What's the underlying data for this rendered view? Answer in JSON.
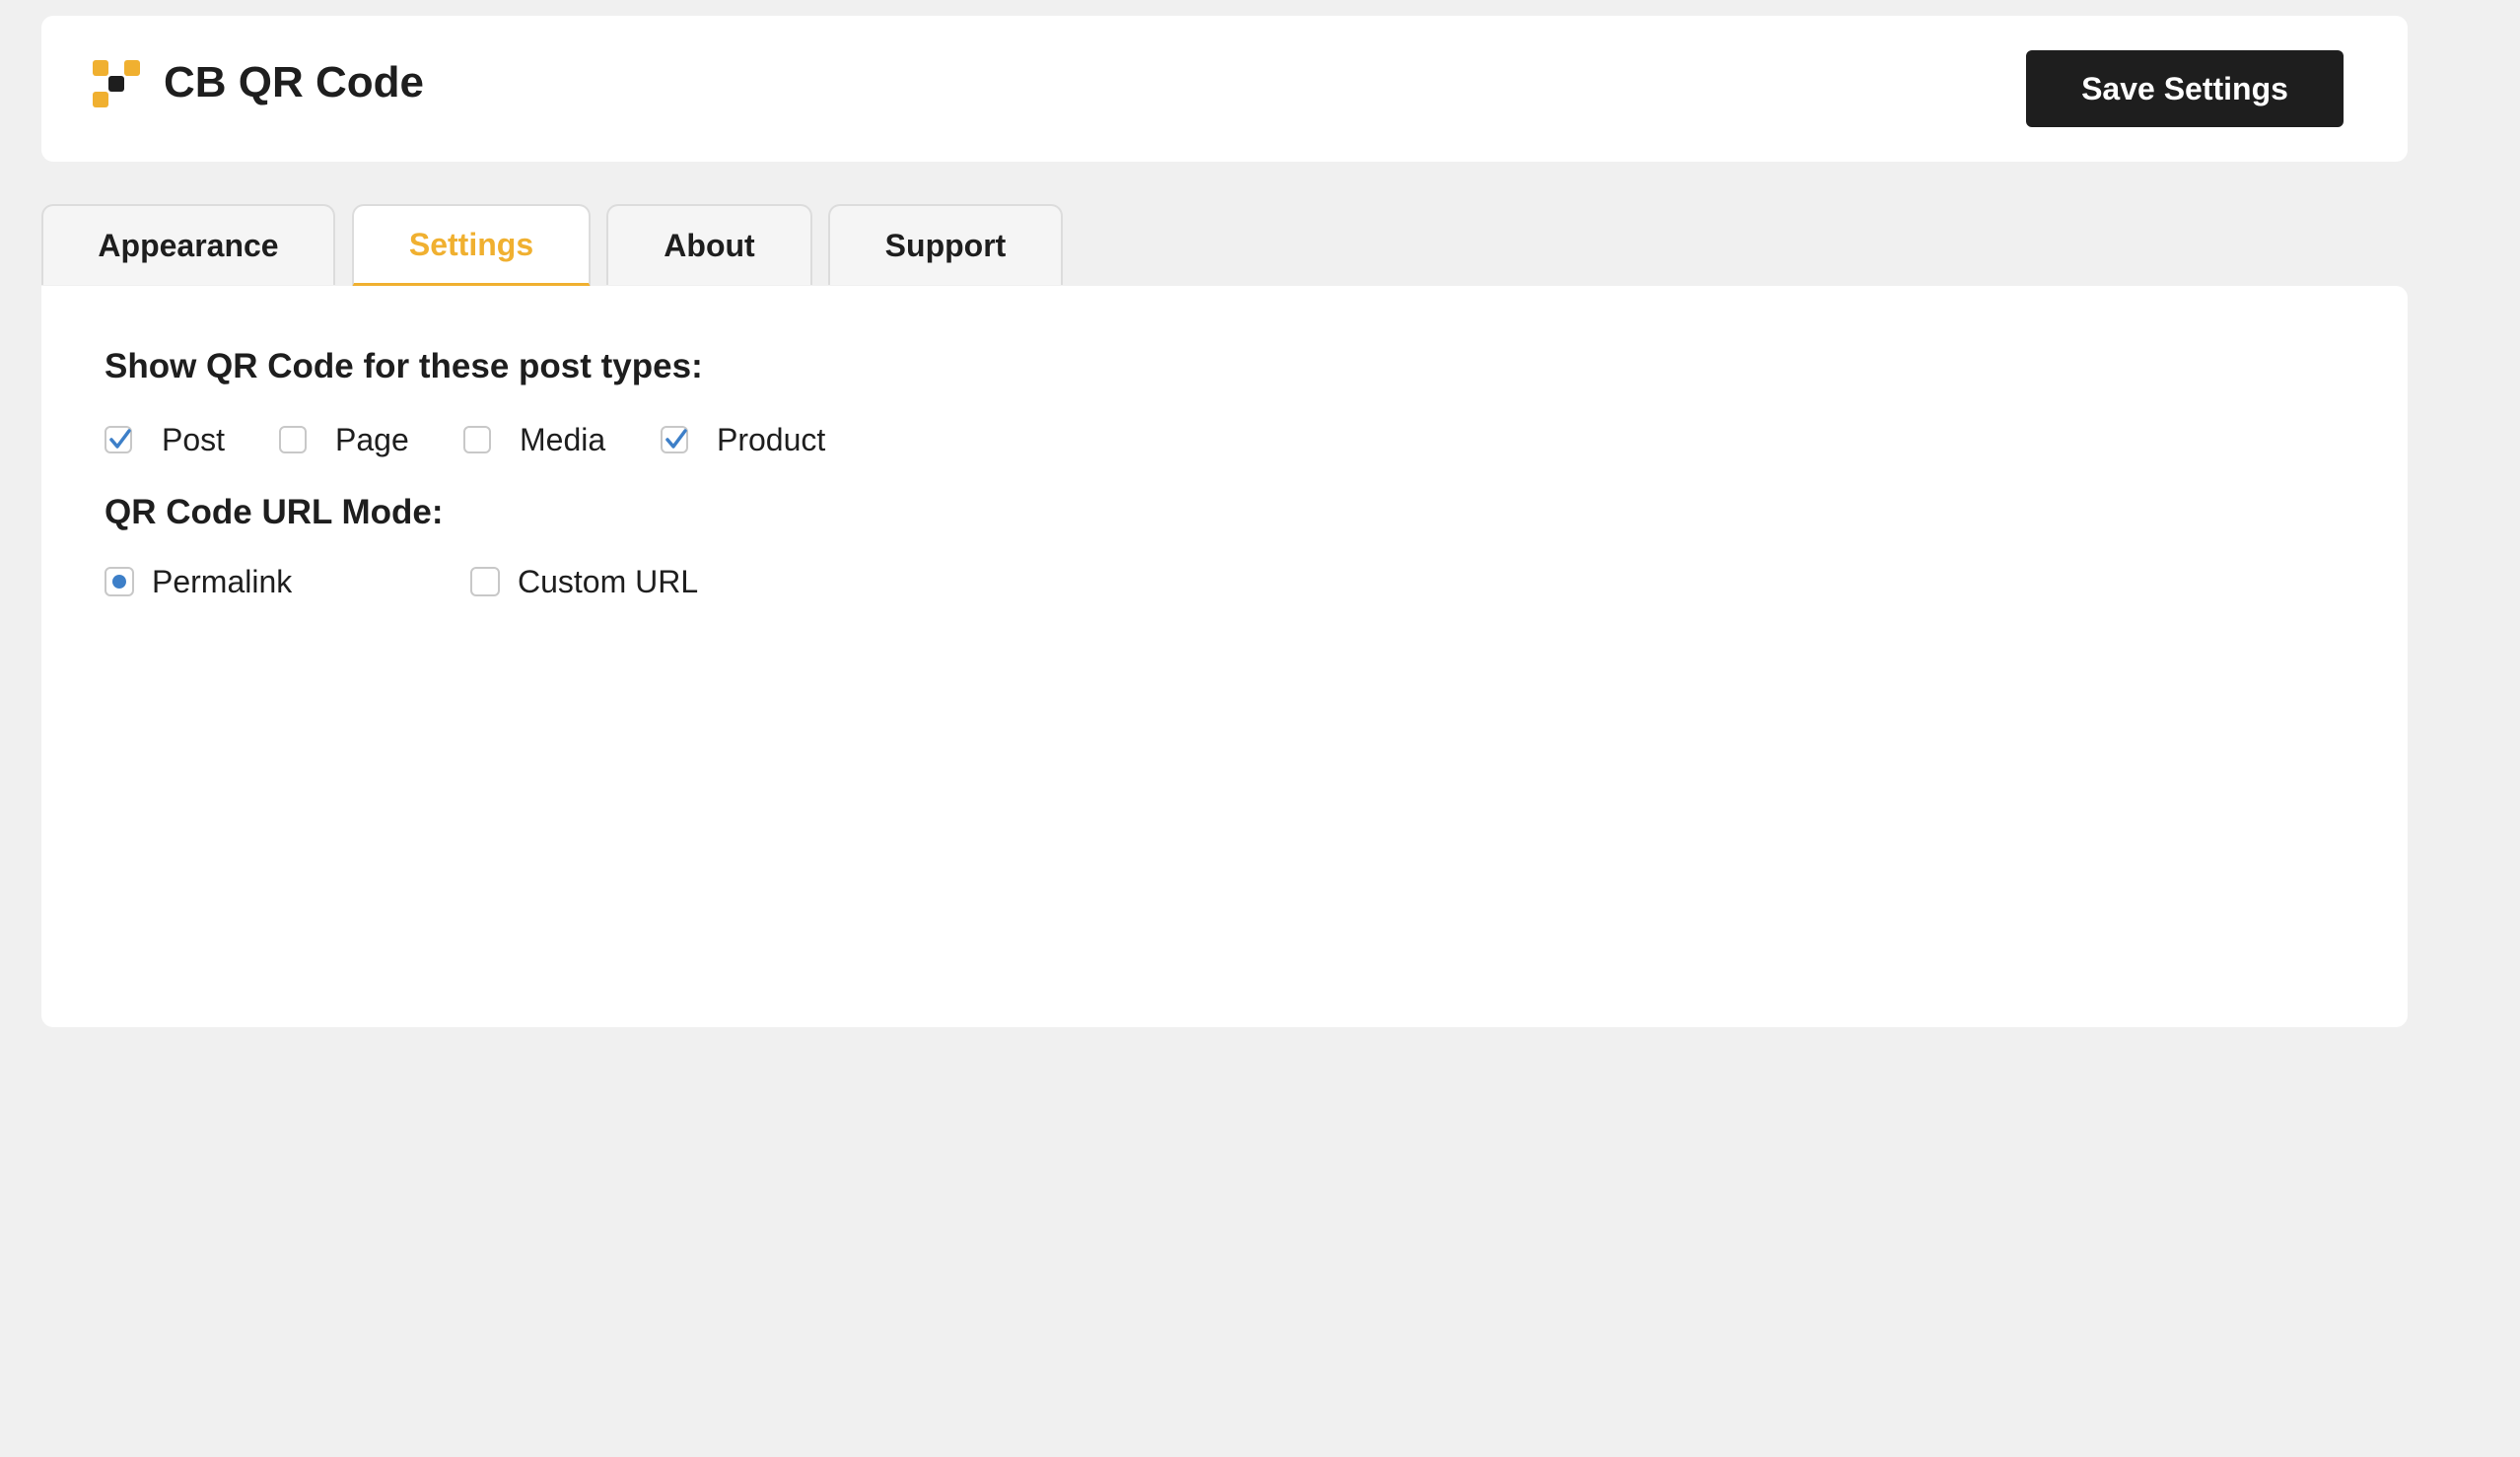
{
  "app": {
    "title": "CB QR Code",
    "logo_icon": "qr-code-icon",
    "save_label": "Save Settings"
  },
  "colors": {
    "accent": "#f0b030",
    "dark": "#1e1e1e",
    "check": "#3d7fc8",
    "page_bg": "#f0f0f0"
  },
  "tabs": [
    {
      "label": "Appearance",
      "active": false
    },
    {
      "label": "Settings",
      "active": true
    },
    {
      "label": "About",
      "active": false
    },
    {
      "label": "Support",
      "active": false
    }
  ],
  "settings": {
    "post_types": {
      "heading": "Show QR Code for these post types:",
      "options": [
        {
          "label": "Post",
          "checked": true
        },
        {
          "label": "Page",
          "checked": false
        },
        {
          "label": "Media",
          "checked": false
        },
        {
          "label": "Product",
          "checked": true
        }
      ]
    },
    "url_mode": {
      "heading": "QR Code URL Mode:",
      "options": [
        {
          "label": "Permalink",
          "selected": true
        },
        {
          "label": "Custom URL",
          "selected": false
        }
      ]
    }
  }
}
